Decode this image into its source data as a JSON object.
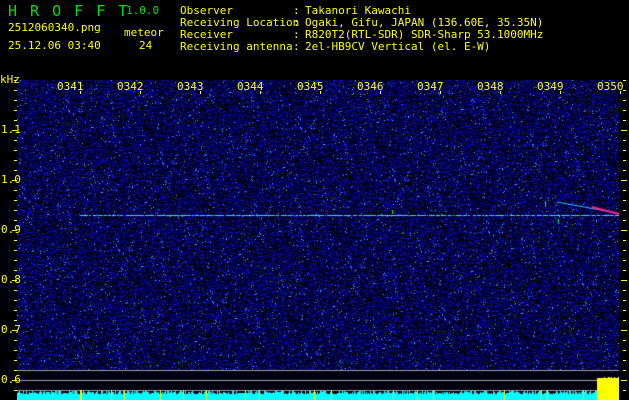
{
  "header": {
    "app_name": "H R O F F T",
    "version": "1.0.0",
    "filename": "2512060340.png",
    "datetime": "25.12.06 03:40",
    "meteor_label": "meteor",
    "meteor_count": "24",
    "info": [
      {
        "label": "Observer",
        "value": "Takanori Kawachi"
      },
      {
        "label": "Receiving Location",
        "value": "Ogaki, Gifu, JAPAN (136.60E, 35.35N)"
      },
      {
        "label": "Receiver",
        "value": "R820T2(RTL-SDR) SDR-Sharp 53.1000MHz"
      },
      {
        "label": "Receiving antenna",
        "value": "2el-HB9CV Vertical (el. E-W)"
      }
    ],
    "separator": ":"
  },
  "spectrogram": {
    "y_unit": "kHz",
    "y_ticks": [
      "1.1",
      "1.0",
      "0.9",
      "0.8",
      "0.7",
      "0.6"
    ],
    "y_range_khz": [
      0.56,
      1.2
    ],
    "x_ticks": [
      "0341",
      "0342",
      "0343",
      "0344",
      "0345",
      "0346",
      "0347",
      "0348",
      "0349",
      "0350"
    ],
    "carrier_khz": 0.93,
    "colors": {
      "noise": "#0000c0",
      "carrier": "#40d0ff",
      "meteor": "#ff2080",
      "text": "#ffff00",
      "level": "#00ffff"
    }
  }
}
